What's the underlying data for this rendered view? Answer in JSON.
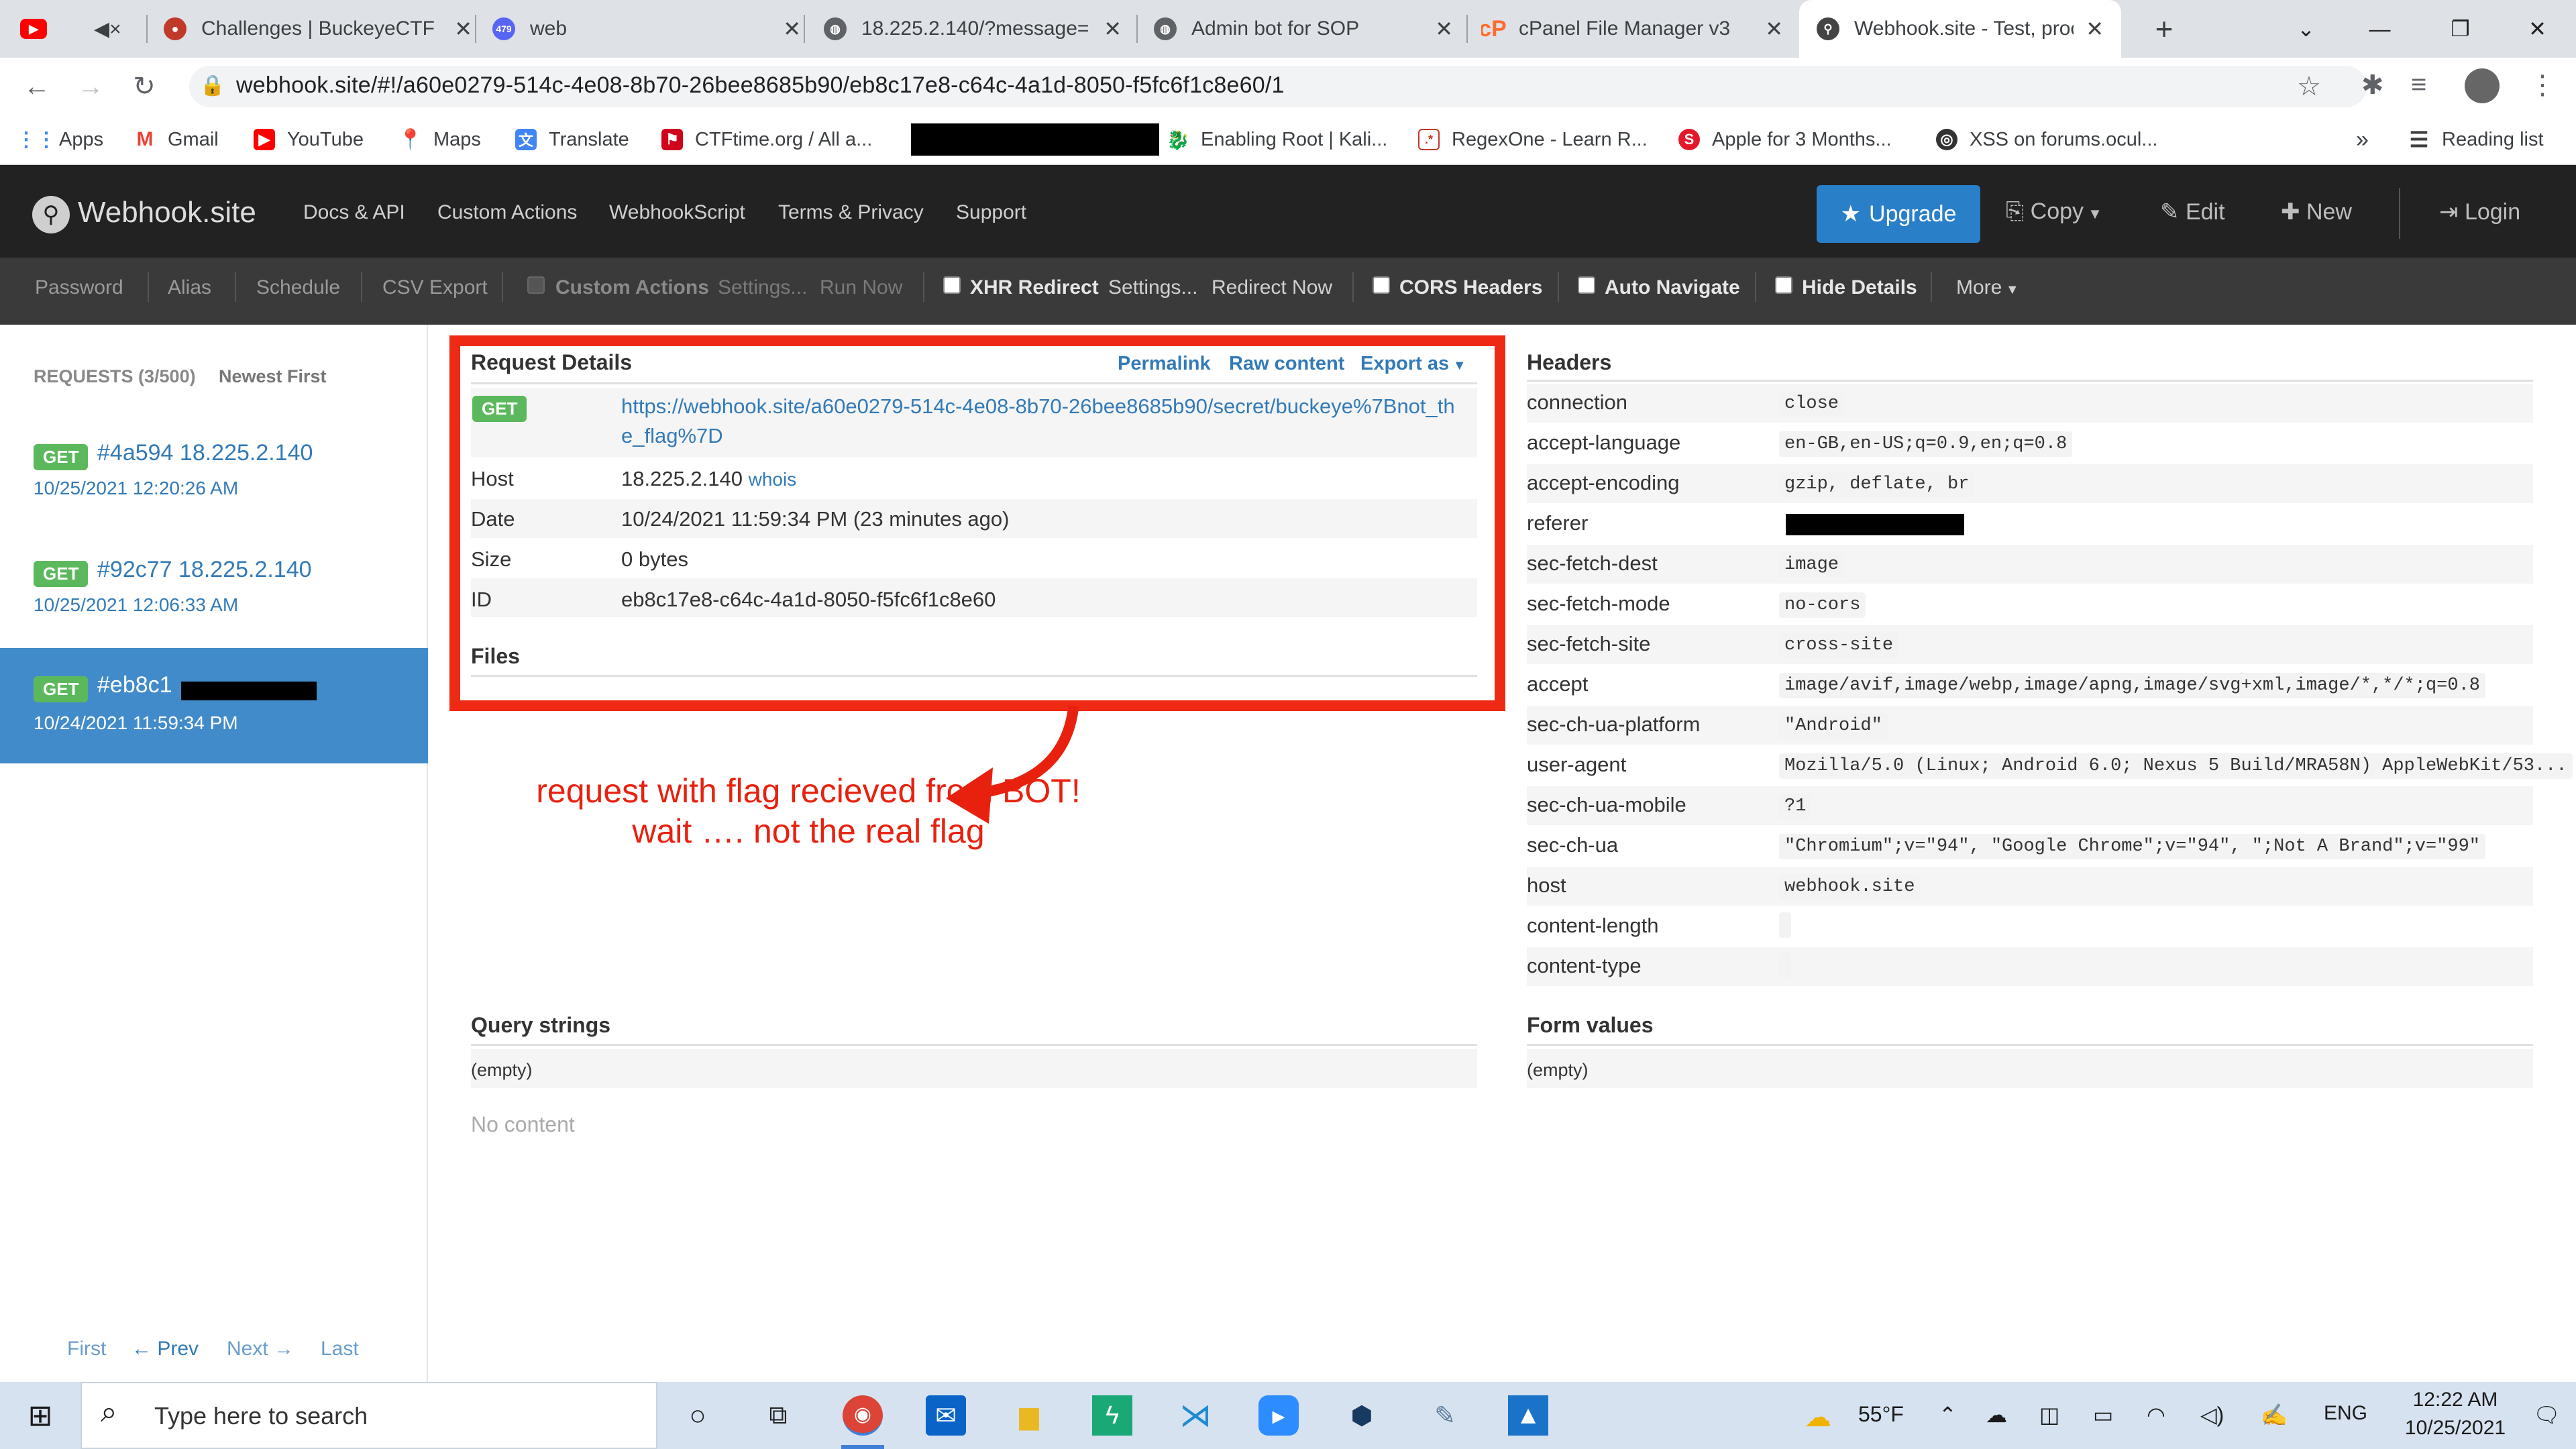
{
  "browser": {
    "tabs": [
      {
        "title": "",
        "favicon": "youtube-icon"
      },
      {
        "title": "",
        "favicon": "mute-icon"
      },
      {
        "title": "Challenges | BuckeyeCTF",
        "favicon": "buckeye-icon"
      },
      {
        "title": "web",
        "favicon": "discord-icon",
        "badge": "479"
      },
      {
        "title": "18.225.2.140/?message=",
        "favicon": "globe-icon"
      },
      {
        "title": "Admin bot for SOP",
        "favicon": "globe-icon"
      },
      {
        "title": "cPanel File Manager v3",
        "favicon": "cpanel-icon"
      },
      {
        "title": "Webhook.site - Test, proc",
        "favicon": "webhook-icon"
      }
    ],
    "new_tab": "+",
    "url": "webhook.site/#!/a60e0279-514c-4e08-8b70-26bee8685b90/eb8c17e8-c64c-4a1d-8050-f5fc6f1c8e60/1",
    "bookmarks": [
      {
        "label": "Apps"
      },
      {
        "label": "Gmail"
      },
      {
        "label": "YouTube"
      },
      {
        "label": "Maps"
      },
      {
        "label": "Translate"
      },
      {
        "label": "CTFtime.org / All a..."
      },
      {
        "label": "Enabling Root | Kali..."
      },
      {
        "label": "RegexOne - Learn R..."
      },
      {
        "label": "Apple for 3 Months..."
      },
      {
        "label": "XSS on forums.ocul..."
      }
    ],
    "bookmarks_more": "»",
    "reading_list": "Reading list"
  },
  "site": {
    "brand": "Webhook.site",
    "nav": [
      "Docs & API",
      "Custom Actions",
      "WebhookScript",
      "Terms & Privacy",
      "Support"
    ],
    "upgrade": "Upgrade",
    "copy": "Copy",
    "edit": "Edit",
    "new": "New",
    "login": "Login",
    "subnav": {
      "password": "Password",
      "alias": "Alias",
      "schedule": "Schedule",
      "csv_export": "CSV Export",
      "custom_actions": "Custom Actions",
      "settings1": "Settings...",
      "run_now": "Run Now",
      "xhr_redirect": "XHR Redirect",
      "settings2": "Settings...",
      "redirect_now": "Redirect Now",
      "cors_headers": "CORS Headers",
      "auto_navigate": "Auto Navigate",
      "hide_details": "Hide Details",
      "more": "More"
    }
  },
  "sidebar": {
    "requests_label": "REQUESTS (3/500)",
    "sort_label": "Newest First",
    "requests": [
      {
        "method": "GET",
        "id": "#4a594",
        "ip": "18.225.2.140",
        "time": "10/25/2021 12:20:26 AM"
      },
      {
        "method": "GET",
        "id": "#92c77",
        "ip": "18.225.2.140",
        "time": "10/25/2021 12:06:33 AM"
      },
      {
        "method": "GET",
        "id": "#eb8c1",
        "ip": "",
        "time": "10/24/2021 11:59:34 PM"
      }
    ],
    "pager": {
      "first": "First",
      "prev": "← Prev",
      "next": "Next →",
      "last": "Last"
    }
  },
  "details": {
    "title": "Request Details",
    "permalink": "Permalink",
    "raw_content": "Raw content",
    "export_as": "Export as",
    "method": "GET",
    "url_line1": "https://webhook.site/a60e0279-514c-4e08-8b70-26bee8685b90/secret/buckeye%7Bnot_th",
    "url_line2": "e_flag%7D",
    "host_label": "Host",
    "host": "18.225.2.140",
    "whois": "whois",
    "date_label": "Date",
    "date": "10/24/2021 11:59:34 PM (23 minutes ago)",
    "size_label": "Size",
    "size": "0 bytes",
    "id_label": "ID",
    "id": "eb8c17e8-c64c-4a1d-8050-f5fc6f1c8e60",
    "files": "Files"
  },
  "annotation": {
    "line1": "request with flag recieved from BOT!",
    "line2": "wait …. not the real flag",
    "color": "#e8210f"
  },
  "headers": {
    "title": "Headers",
    "rows": [
      {
        "k": "connection",
        "v": "close"
      },
      {
        "k": "accept-language",
        "v": "en-GB,en-US;q=0.9,en;q=0.8"
      },
      {
        "k": "accept-encoding",
        "v": "gzip, deflate, br"
      },
      {
        "k": "referer",
        "v": ""
      },
      {
        "k": "sec-fetch-dest",
        "v": "image"
      },
      {
        "k": "sec-fetch-mode",
        "v": "no-cors"
      },
      {
        "k": "sec-fetch-site",
        "v": "cross-site"
      },
      {
        "k": "accept",
        "v": "image/avif,image/webp,image/apng,image/svg+xml,image/*,*/*;q=0.8"
      },
      {
        "k": "sec-ch-ua-platform",
        "v": "\"Android\""
      },
      {
        "k": "user-agent",
        "v": "Mozilla/5.0 (Linux; Android 6.0; Nexus 5 Build/MRA58N) AppleWebKit/53..."
      },
      {
        "k": "sec-ch-ua-mobile",
        "v": "?1"
      },
      {
        "k": "sec-ch-ua",
        "v": "\"Chromium\";v=\"94\", \"Google Chrome\";v=\"94\", \";Not A Brand\";v=\"99\""
      },
      {
        "k": "host",
        "v": "webhook.site"
      },
      {
        "k": "content-length",
        "v": ""
      },
      {
        "k": "content-type",
        "v": ""
      }
    ]
  },
  "query": {
    "title": "Query strings",
    "empty": "(empty)",
    "no_content": "No content"
  },
  "form": {
    "title": "Form values",
    "empty": "(empty)"
  },
  "taskbar": {
    "search_placeholder": "Type here to search",
    "weather": "55°F",
    "lang": "ENG",
    "time": "12:22 AM",
    "date": "10/25/2021"
  }
}
